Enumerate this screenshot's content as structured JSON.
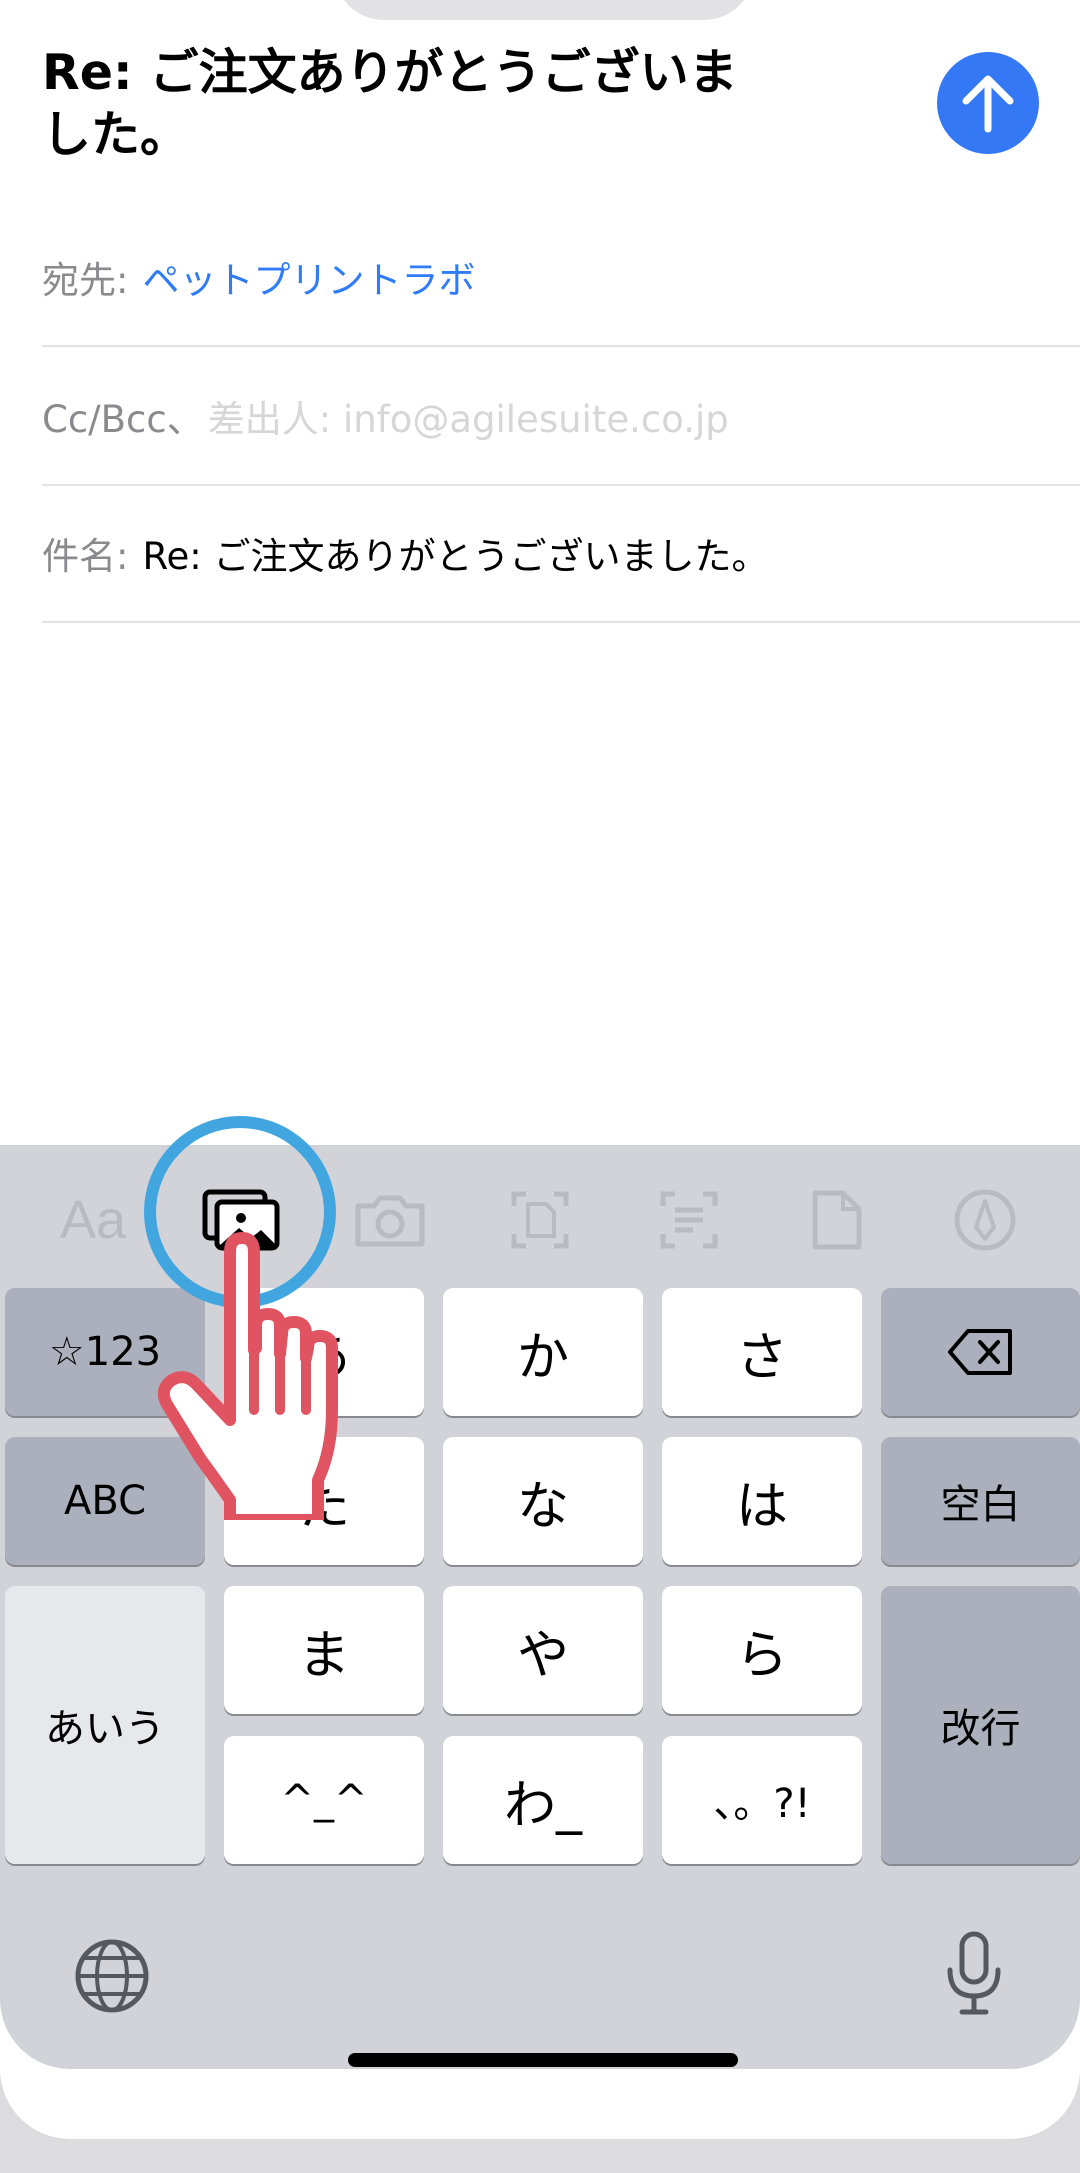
{
  "compose": {
    "title": "Re: ご注文ありがとうございました。",
    "to_label": "宛先:",
    "to_value": "ペットプリントラボ",
    "ccbcc_label": "Cc/Bcc、",
    "ccbcc_placeholder": "差出人: info@agilesuite.co.jp",
    "subject_label": "件名:",
    "subject_value": "Re: ご注文ありがとうございました。"
  },
  "toolbar": {
    "format_label": "Aa",
    "icons": [
      "photo-library-icon",
      "camera-icon",
      "scan-document-icon",
      "scan-text-icon",
      "attach-file-icon",
      "markup-icon"
    ]
  },
  "keyboard": {
    "rows": [
      [
        "☆123",
        "あ",
        "か",
        "さ",
        "⌫"
      ],
      [
        "ABC",
        "た",
        "な",
        "は",
        "空白"
      ],
      [
        "あいう",
        "ま",
        "や",
        "ら",
        "改行"
      ],
      [
        "^_^",
        "わ_",
        "、。?!"
      ]
    ],
    "numbers_key": "☆123",
    "a_key": "あ",
    "ka_key": "か",
    "sa_key": "さ",
    "abc_key": "ABC",
    "ta_key": "た",
    "na_key": "な",
    "ha_key": "は",
    "space_key": "空白",
    "aiu_key": "あいう",
    "ma_key": "ま",
    "ya_key": "や",
    "ra_key": "ら",
    "return_key": "改行",
    "emoticon_key": "^_^",
    "wa_key": "わ_",
    "punct_key": "、。?!"
  },
  "colors": {
    "accent": "#3478f6",
    "link": "#2f7cf6",
    "highlight_ring": "#41a6e0",
    "hand_outline": "#e05462"
  }
}
